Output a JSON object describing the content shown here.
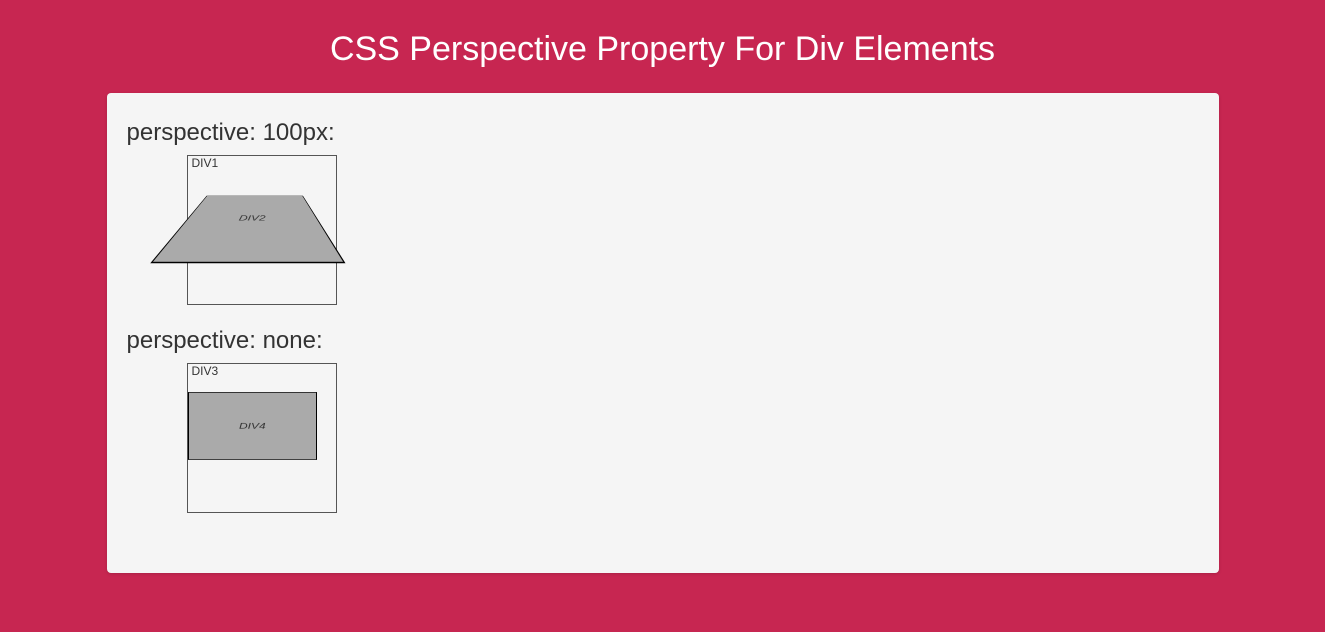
{
  "title": "CSS Perspective Property For Div Elements",
  "example1": {
    "label": "perspective: 100px:",
    "outer_label": "DIV1",
    "inner_label": "DIV2"
  },
  "example2": {
    "label": "perspective: none:",
    "outer_label": "DIV3",
    "inner_label": "DIV4"
  }
}
